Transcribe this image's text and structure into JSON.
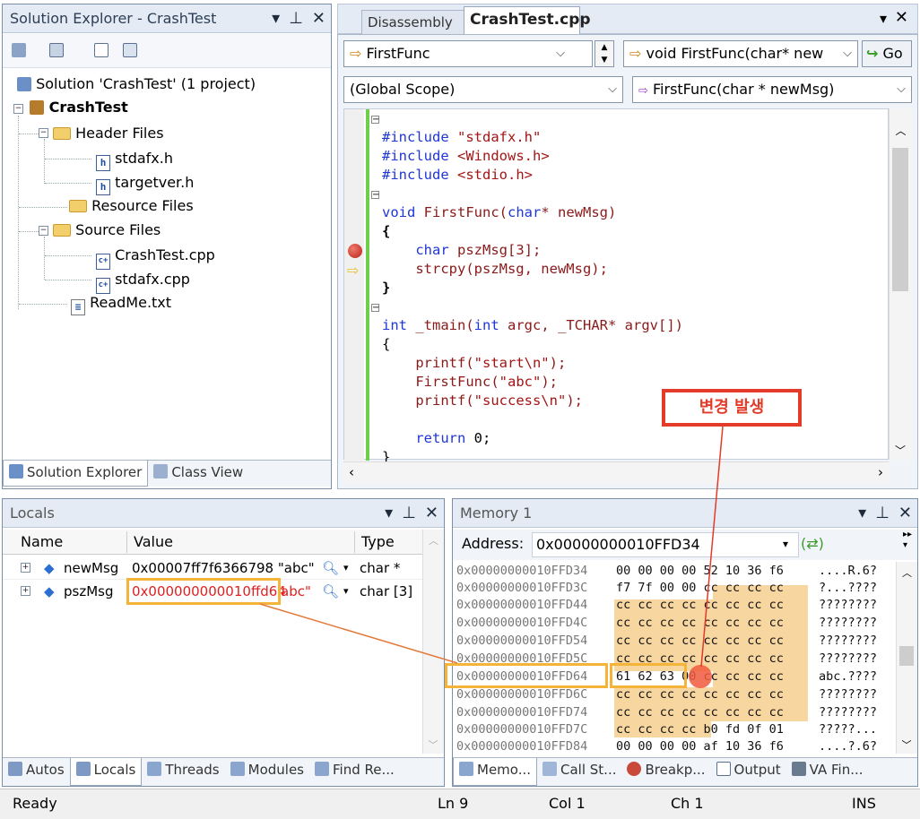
{
  "solution_explorer": {
    "title": "Solution Explorer - CrashTest",
    "solution_label": "Solution 'CrashTest' (1 project)",
    "project": "CrashTest",
    "header_files": "Header Files",
    "stdafx_h": "stdafx.h",
    "targetver_h": "targetver.h",
    "resource_files": "Resource Files",
    "source_files": "Source Files",
    "crashtest_cpp": "CrashTest.cpp",
    "stdafx_cpp": "stdafx.cpp",
    "readme": "ReadMe.txt",
    "tab_solution": "Solution Explorer",
    "tab_class": "Class View"
  },
  "editor": {
    "tab_disasm": "Disassembly",
    "tab_file": "CrashTest.cpp",
    "func_combo": "FirstFunc",
    "sig_combo": "void FirstFunc(char* new",
    "go_label": "Go",
    "scope_combo": "(Global Scope)",
    "member_combo": "FirstFunc(char * newMsg)",
    "code_lines": [
      "#include \"stdafx.h\"",
      "#include <Windows.h>",
      "#include <stdio.h>",
      "",
      "void FirstFunc(char* newMsg)",
      "{",
      "    char pszMsg[3];",
      "    strcpy(pszMsg, newMsg);",
      "}",
      "",
      "int _tmain(int argc, _TCHAR* argv[])",
      "{",
      "    printf(\"start\\n\");",
      "    FirstFunc(\"abc\");",
      "    printf(\"success\\n\");",
      "",
      "    return 0;",
      "}"
    ]
  },
  "callout": {
    "text": "변경 발생"
  },
  "locals": {
    "title": "Locals",
    "col_name": "Name",
    "col_value": "Value",
    "col_type": "Type",
    "rows": [
      {
        "name": "newMsg",
        "value": "0x00007ff7f6366798 \"abc\"",
        "type": "char *"
      },
      {
        "name": "pszMsg",
        "value_addr": "0x000000000010ffd64",
        "value_str": "abc\"",
        "type": "char [3]"
      }
    ],
    "tabs": [
      "Autos",
      "Locals",
      "Threads",
      "Modules",
      "Find Re..."
    ]
  },
  "memory": {
    "title": "Memory 1",
    "address_label": "Address:",
    "address_value": "0x00000000010FFD34",
    "rows": [
      {
        "addr": "0x00000000010FFD34",
        "bytes": "00 00 00 00 52 10 36 f6",
        "ascii": "....R.6?"
      },
      {
        "addr": "0x00000000010FFD3C",
        "bytes": "f7 7f 00 00 cc cc cc cc",
        "ascii": "?...????"
      },
      {
        "addr": "0x00000000010FFD44",
        "bytes": "cc cc cc cc cc cc cc cc",
        "ascii": "????????"
      },
      {
        "addr": "0x00000000010FFD4C",
        "bytes": "cc cc cc cc cc cc cc cc",
        "ascii": "????????"
      },
      {
        "addr": "0x00000000010FFD54",
        "bytes": "cc cc cc cc cc cc cc cc",
        "ascii": "????????"
      },
      {
        "addr": "0x00000000010FFD5C",
        "bytes": "cc cc cc cc cc cc cc cc",
        "ascii": "????????"
      },
      {
        "addr": "0x00000000010FFD64",
        "bytes": "61 62 63 00 cc cc cc cc",
        "ascii": "abc.????"
      },
      {
        "addr": "0x00000000010FFD6C",
        "bytes": "cc cc cc cc cc cc cc cc",
        "ascii": "????????"
      },
      {
        "addr": "0x00000000010FFD74",
        "bytes": "cc cc cc cc cc cc cc cc",
        "ascii": "????????"
      },
      {
        "addr": "0x00000000010FFD7C",
        "bytes": "cc cc cc cc b0 fd 0f 01",
        "ascii": "?????..."
      },
      {
        "addr": "0x00000000010FFD84",
        "bytes": "00 00 00 00 af 10 36 f6",
        "ascii": "....?.6?"
      }
    ],
    "tabs": [
      "Memo...",
      "Call St...",
      "Breakp...",
      "Output",
      "VA Fin..."
    ]
  },
  "status": {
    "ready": "Ready",
    "ln": "Ln 9",
    "col": "Col 1",
    "ch": "Ch 1",
    "ins": "INS"
  }
}
